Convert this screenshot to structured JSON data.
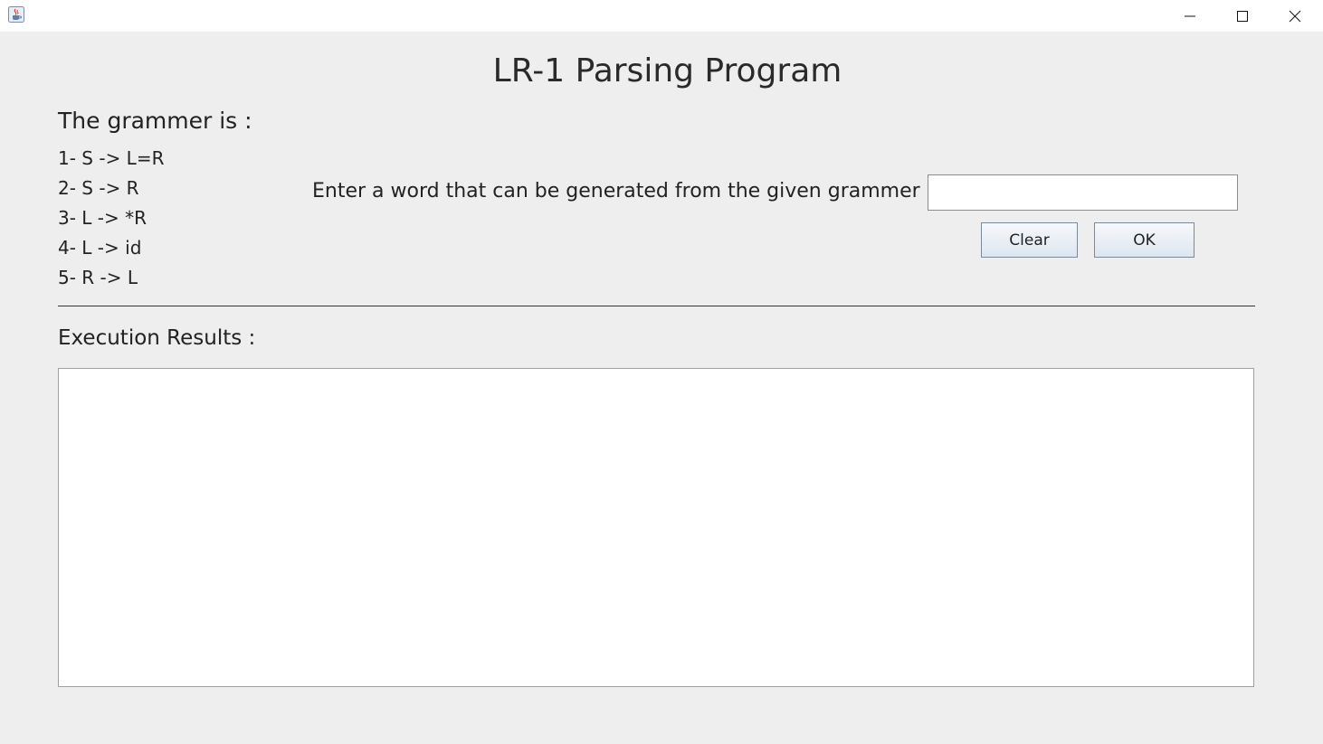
{
  "window": {
    "app_icon": "java-cup-icon",
    "controls": [
      "minimize-icon",
      "maximize-icon",
      "close-icon"
    ]
  },
  "title": "LR-1 Parsing Program",
  "grammar": {
    "heading": "The grammer is :",
    "rules": [
      "1- S -> L=R",
      "2- S -> R",
      "3- L -> *R",
      "4- L -> id",
      "5- R -> L"
    ]
  },
  "input": {
    "prompt": "Enter a word that can be generated from the given grammer :",
    "value": "",
    "placeholder": ""
  },
  "buttons": {
    "clear_label": "Clear",
    "ok_label": "OK"
  },
  "results": {
    "heading": "Execution Results :",
    "text": ""
  },
  "colors": {
    "background": "#eeeeee",
    "titlebar": "#ffffff",
    "button_top": "#f6f8fb",
    "button_bottom": "#dde6ef"
  }
}
